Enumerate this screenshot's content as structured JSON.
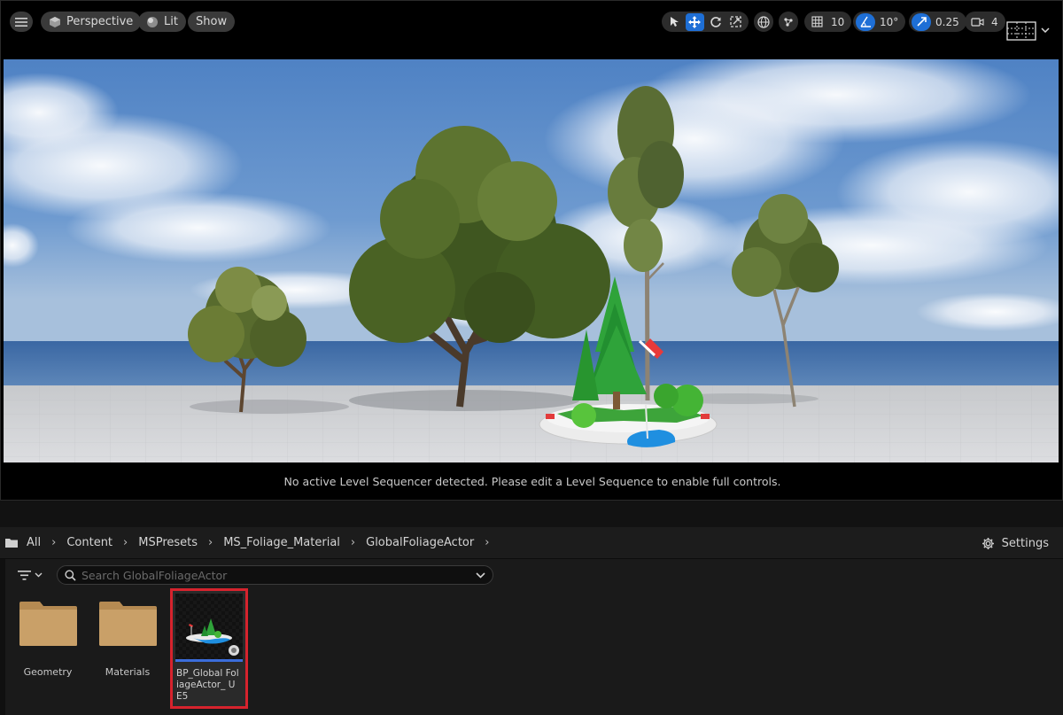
{
  "toolbar": {
    "view_mode": "Perspective",
    "lighting_mode": "Lit",
    "show_label": "Show",
    "grid_snap_value": "10",
    "rotation_snap_value": "10°",
    "scale_snap_value": "0.25",
    "camera_speed_value": "4"
  },
  "viewport": {
    "sequencer_message": "No active Level Sequencer detected. Please edit a Level Sequence to enable full controls."
  },
  "breadcrumb": [
    "All",
    "Content",
    "MSPresets",
    "MS_Foliage_Material",
    "GlobalFoliageActor"
  ],
  "content_browser": {
    "settings_label": "Settings",
    "search_placeholder": "Search GlobalFoliageActor",
    "items": [
      {
        "type": "folder",
        "label": "Geometry"
      },
      {
        "type": "folder",
        "label": "Materials"
      },
      {
        "type": "asset",
        "label": "BP_Global FoliageActor_ UE5",
        "selected": true
      }
    ]
  },
  "colors": {
    "accent": "#1e6fd6",
    "selection_highlight": "#d6232d",
    "folder": "#c9a068",
    "asset_type_bar": "#3b6ddb"
  }
}
